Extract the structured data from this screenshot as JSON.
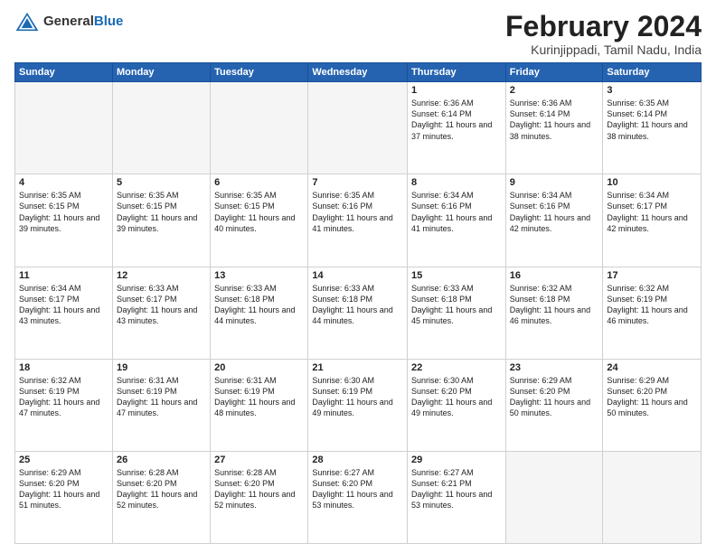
{
  "header": {
    "logo_general": "General",
    "logo_blue": "Blue",
    "month_title": "February 2024",
    "location": "Kurinjippadi, Tamil Nadu, India"
  },
  "weekdays": [
    "Sunday",
    "Monday",
    "Tuesday",
    "Wednesday",
    "Thursday",
    "Friday",
    "Saturday"
  ],
  "weeks": [
    [
      {
        "day": "",
        "info": ""
      },
      {
        "day": "",
        "info": ""
      },
      {
        "day": "",
        "info": ""
      },
      {
        "day": "",
        "info": ""
      },
      {
        "day": "1",
        "info": "Sunrise: 6:36 AM\nSunset: 6:14 PM\nDaylight: 11 hours\nand 37 minutes."
      },
      {
        "day": "2",
        "info": "Sunrise: 6:36 AM\nSunset: 6:14 PM\nDaylight: 11 hours\nand 38 minutes."
      },
      {
        "day": "3",
        "info": "Sunrise: 6:35 AM\nSunset: 6:14 PM\nDaylight: 11 hours\nand 38 minutes."
      }
    ],
    [
      {
        "day": "4",
        "info": "Sunrise: 6:35 AM\nSunset: 6:15 PM\nDaylight: 11 hours\nand 39 minutes."
      },
      {
        "day": "5",
        "info": "Sunrise: 6:35 AM\nSunset: 6:15 PM\nDaylight: 11 hours\nand 39 minutes."
      },
      {
        "day": "6",
        "info": "Sunrise: 6:35 AM\nSunset: 6:15 PM\nDaylight: 11 hours\nand 40 minutes."
      },
      {
        "day": "7",
        "info": "Sunrise: 6:35 AM\nSunset: 6:16 PM\nDaylight: 11 hours\nand 41 minutes."
      },
      {
        "day": "8",
        "info": "Sunrise: 6:34 AM\nSunset: 6:16 PM\nDaylight: 11 hours\nand 41 minutes."
      },
      {
        "day": "9",
        "info": "Sunrise: 6:34 AM\nSunset: 6:16 PM\nDaylight: 11 hours\nand 42 minutes."
      },
      {
        "day": "10",
        "info": "Sunrise: 6:34 AM\nSunset: 6:17 PM\nDaylight: 11 hours\nand 42 minutes."
      }
    ],
    [
      {
        "day": "11",
        "info": "Sunrise: 6:34 AM\nSunset: 6:17 PM\nDaylight: 11 hours\nand 43 minutes."
      },
      {
        "day": "12",
        "info": "Sunrise: 6:33 AM\nSunset: 6:17 PM\nDaylight: 11 hours\nand 43 minutes."
      },
      {
        "day": "13",
        "info": "Sunrise: 6:33 AM\nSunset: 6:18 PM\nDaylight: 11 hours\nand 44 minutes."
      },
      {
        "day": "14",
        "info": "Sunrise: 6:33 AM\nSunset: 6:18 PM\nDaylight: 11 hours\nand 44 minutes."
      },
      {
        "day": "15",
        "info": "Sunrise: 6:33 AM\nSunset: 6:18 PM\nDaylight: 11 hours\nand 45 minutes."
      },
      {
        "day": "16",
        "info": "Sunrise: 6:32 AM\nSunset: 6:18 PM\nDaylight: 11 hours\nand 46 minutes."
      },
      {
        "day": "17",
        "info": "Sunrise: 6:32 AM\nSunset: 6:19 PM\nDaylight: 11 hours\nand 46 minutes."
      }
    ],
    [
      {
        "day": "18",
        "info": "Sunrise: 6:32 AM\nSunset: 6:19 PM\nDaylight: 11 hours\nand 47 minutes."
      },
      {
        "day": "19",
        "info": "Sunrise: 6:31 AM\nSunset: 6:19 PM\nDaylight: 11 hours\nand 47 minutes."
      },
      {
        "day": "20",
        "info": "Sunrise: 6:31 AM\nSunset: 6:19 PM\nDaylight: 11 hours\nand 48 minutes."
      },
      {
        "day": "21",
        "info": "Sunrise: 6:30 AM\nSunset: 6:19 PM\nDaylight: 11 hours\nand 49 minutes."
      },
      {
        "day": "22",
        "info": "Sunrise: 6:30 AM\nSunset: 6:20 PM\nDaylight: 11 hours\nand 49 minutes."
      },
      {
        "day": "23",
        "info": "Sunrise: 6:29 AM\nSunset: 6:20 PM\nDaylight: 11 hours\nand 50 minutes."
      },
      {
        "day": "24",
        "info": "Sunrise: 6:29 AM\nSunset: 6:20 PM\nDaylight: 11 hours\nand 50 minutes."
      }
    ],
    [
      {
        "day": "25",
        "info": "Sunrise: 6:29 AM\nSunset: 6:20 PM\nDaylight: 11 hours\nand 51 minutes."
      },
      {
        "day": "26",
        "info": "Sunrise: 6:28 AM\nSunset: 6:20 PM\nDaylight: 11 hours\nand 52 minutes."
      },
      {
        "day": "27",
        "info": "Sunrise: 6:28 AM\nSunset: 6:20 PM\nDaylight: 11 hours\nand 52 minutes."
      },
      {
        "day": "28",
        "info": "Sunrise: 6:27 AM\nSunset: 6:20 PM\nDaylight: 11 hours\nand 53 minutes."
      },
      {
        "day": "29",
        "info": "Sunrise: 6:27 AM\nSunset: 6:21 PM\nDaylight: 11 hours\nand 53 minutes."
      },
      {
        "day": "",
        "info": ""
      },
      {
        "day": "",
        "info": ""
      }
    ]
  ]
}
